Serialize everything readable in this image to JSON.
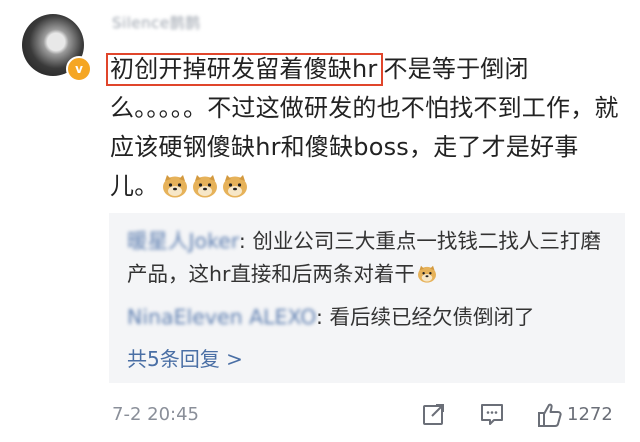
{
  "comment": {
    "username": "Silence鹊鹊",
    "text_highlighted": "初创开掉研发留着傻缺hr",
    "text_rest": "不是等于倒闭么。。。。。不过这做研发的也不怕找不到工作，就应该硬钢傻缺hr和傻缺boss，走了才是好事儿。",
    "emoji_count": 3,
    "emoji_icon": "doge-icon"
  },
  "replies": [
    {
      "name": "暖星人Joker",
      "separator": ": ",
      "text": "创业公司三大重点一找钱二找人三打磨产品，这hr直接和后两条对着干"
    },
    {
      "name": "NinaEleven ALEXO",
      "separator": ": ",
      "text": "看后续已经欠债倒闭了"
    }
  ],
  "more_replies_label": "共5条回复 >",
  "footer": {
    "timestamp": "7-2 20:45",
    "share_icon": "share-icon",
    "comment_icon": "comment-icon",
    "like_icon": "thumbs-up-icon",
    "like_count": "1272"
  },
  "colors": {
    "highlight_border": "#e0452b",
    "link_blue": "#4a6fa5",
    "reply_bg": "#f4f5f7",
    "meta_gray": "#8a8f99"
  }
}
